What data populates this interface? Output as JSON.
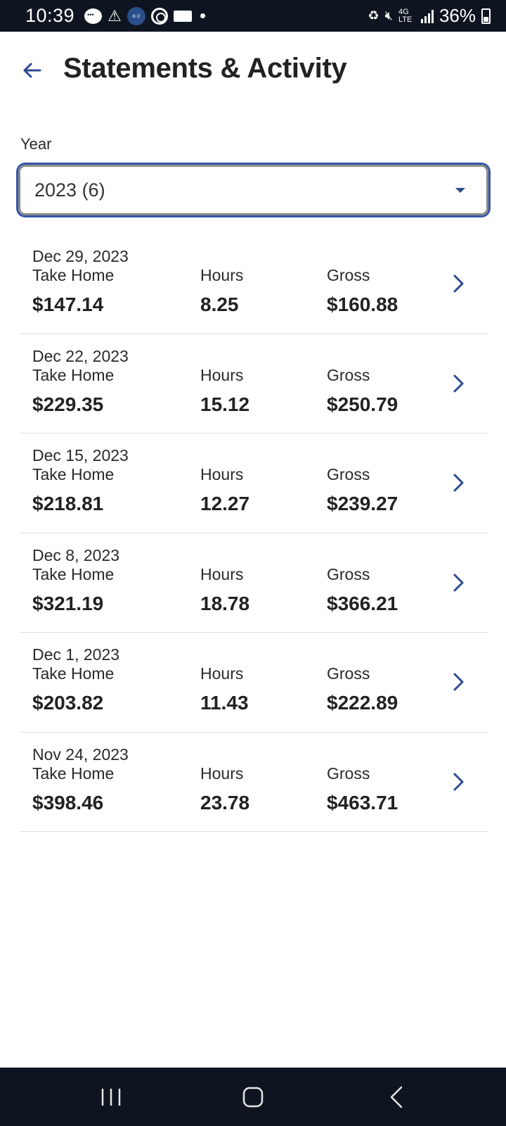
{
  "status_bar": {
    "time": "10:39",
    "network": "4G LTE",
    "battery": "36%",
    "icons": [
      "chat-icon",
      "warning-icon",
      "amazon-a-to-z-icon",
      "chrome-icon",
      "rectangle-icon",
      "dot-icon",
      "recycle-battery-icon",
      "mute-icon",
      "signal-icon",
      "battery-icon"
    ]
  },
  "header": {
    "title": "Statements & Activity",
    "back_icon": "arrow-left-icon"
  },
  "year_filter": {
    "label": "Year",
    "selected": "2023 (6)"
  },
  "statement_labels": {
    "take_home": "Take Home",
    "hours": "Hours",
    "gross": "Gross"
  },
  "statements": [
    {
      "date": "Dec 29, 2023",
      "take_home": "$147.14",
      "hours": "8.25",
      "gross": "$160.88"
    },
    {
      "date": "Dec 22, 2023",
      "take_home": "$229.35",
      "hours": "15.12",
      "gross": "$250.79"
    },
    {
      "date": "Dec 15, 2023",
      "take_home": "$218.81",
      "hours": "12.27",
      "gross": "$239.27"
    },
    {
      "date": "Dec 8, 2023",
      "take_home": "$321.19",
      "hours": "18.78",
      "gross": "$366.21"
    },
    {
      "date": "Dec 1, 2023",
      "take_home": "$203.82",
      "hours": "11.43",
      "gross": "$222.89"
    },
    {
      "date": "Nov 24, 2023",
      "take_home": "$398.46",
      "hours": "23.78",
      "gross": "$463.71"
    }
  ],
  "colors": {
    "accent": "#2c4a8f",
    "focus_ring": "#3657a8",
    "system_bar": "#0f1520",
    "divider": "#dedede"
  },
  "nav_bar": {
    "icons": [
      "recents-icon",
      "home-icon",
      "back-icon"
    ]
  }
}
